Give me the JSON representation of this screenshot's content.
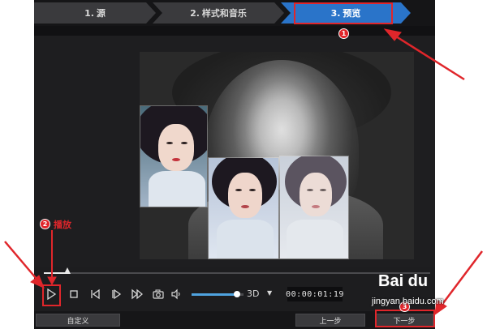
{
  "wizard": {
    "steps": [
      {
        "number": "1.",
        "label": "源"
      },
      {
        "number": "2.",
        "label": "样式和音乐"
      },
      {
        "number": "3.",
        "label": "预览"
      }
    ],
    "active_step": 3
  },
  "player": {
    "timeline_progress_fraction": 0.06,
    "volume_fraction": 0.88,
    "mode": "3D",
    "timecode": "00:00:01:19",
    "icons": [
      "play-icon",
      "stop-icon",
      "prev-frame-icon",
      "next-frame-icon",
      "fast-forward-icon",
      "camera-icon",
      "speaker-icon",
      "dropdown-caret-icon"
    ]
  },
  "buttons": {
    "custom": "自定义",
    "prev": "上一步",
    "next": "下一步"
  },
  "annotations": {
    "marker1": "1",
    "marker2": "2",
    "marker3": "3",
    "play_label": "播放",
    "color": "#e0262b"
  },
  "watermark": {
    "logo": "Bai du",
    "site": "jingyan.baidu.com"
  },
  "colors": {
    "accent": "#2a74c9",
    "app_bg": "#1d1d1f"
  }
}
